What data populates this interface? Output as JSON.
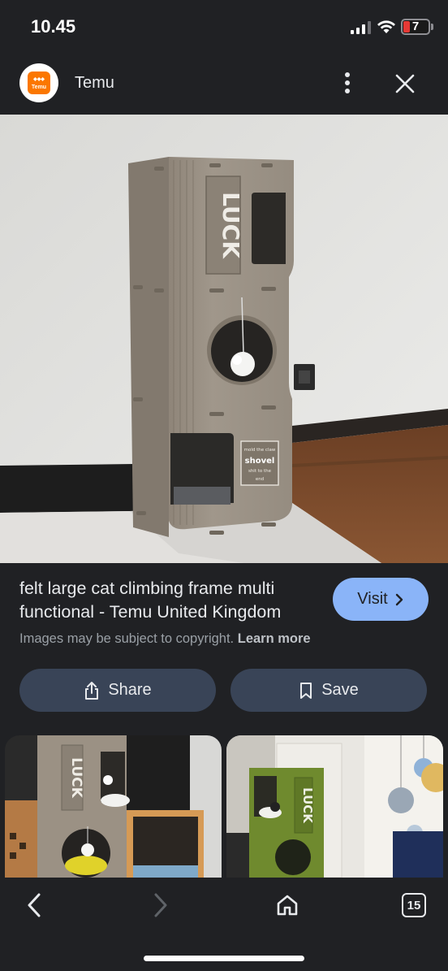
{
  "status_bar": {
    "time": "10.45",
    "battery_level": "7"
  },
  "header": {
    "site_logo_text": "Temu",
    "site_name": "Temu"
  },
  "main_image": {
    "board_text": "LUCK",
    "tag_text_1": "mold the claw",
    "tag_text_2": "shovel",
    "tag_text_3": "shit to the",
    "tag_text_4": "end"
  },
  "result": {
    "title": "felt large cat climbing frame multi functional - Temu United Kingdom",
    "visit_label": "Visit",
    "copyright_text": "Images may be subject to copyright.",
    "learn_more_label": "Learn more"
  },
  "actions": {
    "share_label": "Share",
    "save_label": "Save"
  },
  "related": [
    {
      "board_text": "LUCK"
    },
    {
      "board_text": "LUCK"
    }
  ],
  "bottom_nav": {
    "tab_count": "15"
  },
  "colors": {
    "background": "#202124",
    "accent_button": "#8ab4f8",
    "action_button": "#394457",
    "temu_orange": "#fb7701"
  }
}
